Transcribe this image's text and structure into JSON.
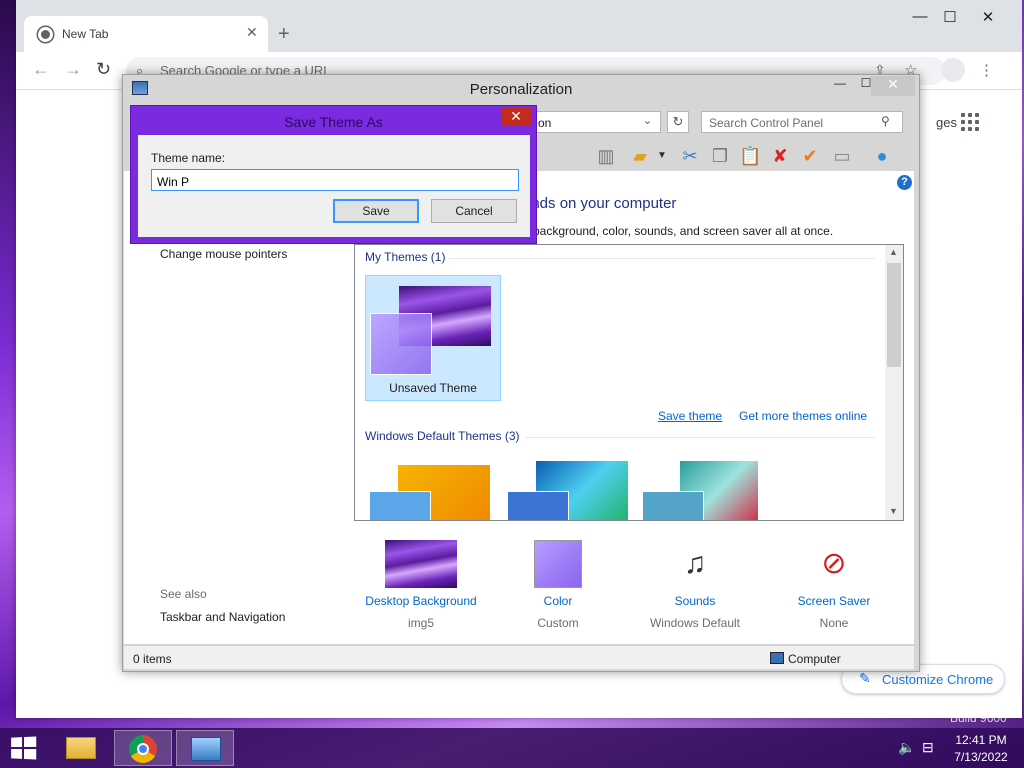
{
  "chrome": {
    "tab_title": "New Tab",
    "omnibox_placeholder": "Search Google or type a URL",
    "images_link": "ges",
    "customize_label": "Customize Chrome",
    "new_tab_glyph": "+",
    "close_glyph": "✕"
  },
  "personalization": {
    "title": "Personalization",
    "address_text": "on",
    "search_placeholder": "Search Control Panel",
    "heading": "unds on your computer",
    "subtitle": "p background, color, sounds, and screen saver all at once.",
    "nav_mouse": "Change mouse pointers",
    "see_also": "See also",
    "nav_taskbar": "Taskbar and Navigation",
    "my_themes_header": "My Themes (1)",
    "unsaved_theme": "Unsaved Theme",
    "save_theme_link": "Save theme",
    "get_more_link": "Get more themes online",
    "windows_default_header": "Windows Default Themes (3)",
    "bottom": [
      {
        "label": "Desktop Background",
        "value": "img5"
      },
      {
        "label": "Color",
        "value": "Custom"
      },
      {
        "label": "Sounds",
        "value": "Windows Default"
      },
      {
        "label": "Screen Saver",
        "value": "None"
      }
    ],
    "status_items": "0 items",
    "status_computer": "Computer"
  },
  "dialog": {
    "title": "Save Theme As",
    "label": "Theme name:",
    "input_value": "Win P",
    "save": "Save",
    "cancel": "Cancel"
  },
  "taskbar": {
    "time": "12:41 PM",
    "date": "7/13/2022"
  },
  "desktop": {
    "build": "Build 9600"
  },
  "colors": {
    "dialog_frame": "#7a2be0",
    "link": "#0066cc",
    "heading": "#1e3287",
    "selection": "#cce8ff"
  }
}
